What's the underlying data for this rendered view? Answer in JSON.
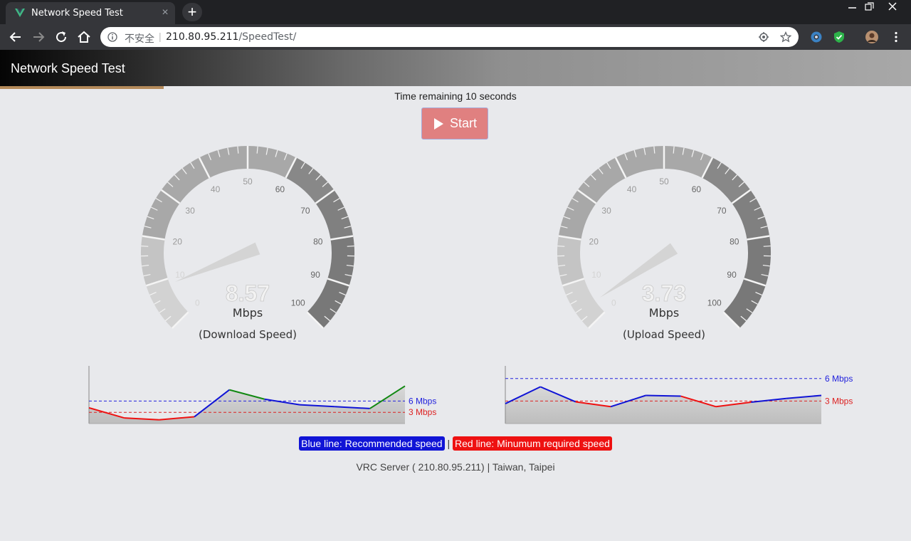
{
  "browser": {
    "tab_title": "Network Speed Test",
    "tab_close": "×",
    "new_tab": "+",
    "insecure_label": "不安全",
    "url_host": "210.80.95.211",
    "url_path": "/SpeedTest/"
  },
  "page": {
    "title": "Network Speed Test",
    "timer_text": "Time remaining 10 seconds",
    "start_label": "Start",
    "progress_fraction": 0.18
  },
  "gauges": [
    {
      "value": "8.57",
      "unit": "Mbps",
      "label": "(Download Speed)",
      "ticks": [
        "0",
        "10",
        "20",
        "30",
        "40",
        "50",
        "60",
        "70",
        "80",
        "90",
        "100"
      ]
    },
    {
      "value": "3.73",
      "unit": "Mbps",
      "label": "(Upload Speed)",
      "ticks": [
        "0",
        "10",
        "20",
        "30",
        "40",
        "50",
        "60",
        "70",
        "80",
        "90",
        "100"
      ]
    }
  ],
  "chart_data": [
    {
      "type": "line",
      "x": [
        0,
        1,
        2,
        3,
        4,
        5,
        6,
        7,
        8,
        9
      ],
      "values": [
        4.2,
        1.5,
        1.0,
        1.8,
        9.0,
        6.5,
        5.0,
        4.5,
        4.0,
        10.0
      ],
      "ylim": [
        0,
        15
      ],
      "reference_lines": [
        {
          "label": "6 Mbps",
          "value": 6,
          "color": "#2222dd"
        },
        {
          "label": "3 Mbps",
          "value": 3,
          "color": "#dd2222"
        }
      ]
    },
    {
      "type": "line",
      "x": [
        0,
        1,
        2,
        3,
        4,
        5,
        6,
        7,
        8,
        9
      ],
      "values": [
        5.3,
        9.8,
        5.8,
        4.5,
        7.5,
        7.3,
        4.5,
        5.7,
        6.7,
        7.5
      ],
      "ylim": [
        0,
        15
      ],
      "reference_lines": [
        {
          "label": "6 Mbps",
          "value": 12,
          "color": "#2222dd"
        },
        {
          "label": "3 Mbps",
          "value": 6,
          "color": "#dd2222"
        }
      ]
    }
  ],
  "legend": {
    "blue_text": "Blue line: Recommended speed",
    "separator": "|",
    "red_text": "Red line: Minumum required speed"
  },
  "server_text": "VRC Server ( 210.80.95.211) | Taiwan, Taipei",
  "colors": {
    "recommended": "#1014d6",
    "minimum": "#ee1111",
    "above": "#118811"
  }
}
